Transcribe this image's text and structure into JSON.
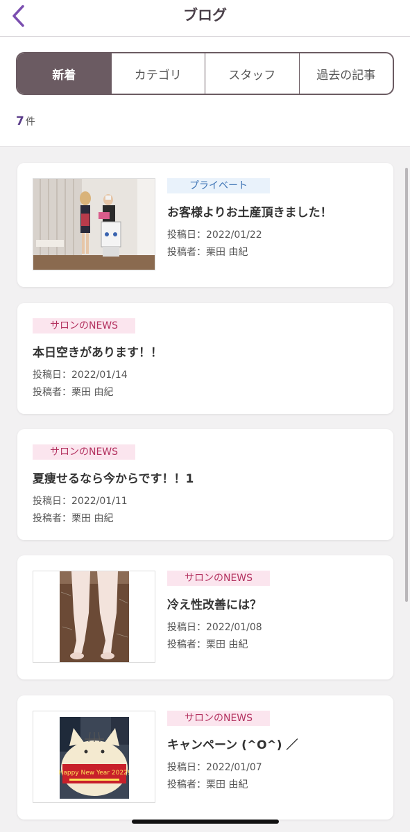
{
  "header": {
    "title": "ブログ"
  },
  "tabs": [
    {
      "label": "新着"
    },
    {
      "label": "カテゴリ"
    },
    {
      "label": "スタッフ"
    },
    {
      "label": "過去の記事"
    }
  ],
  "count": {
    "number": "7",
    "unit": "件"
  },
  "posts": [
    {
      "category": "プライベート",
      "title": "お客様よりお土産頂きました！",
      "date": "投稿日：2022/01/22",
      "author": "投稿者：栗田 由紀"
    },
    {
      "category": "サロンのNEWS",
      "title": "本日空きがあります！！",
      "date": "投稿日：2022/01/14",
      "author": "投稿者：栗田 由紀"
    },
    {
      "category": "サロンのNEWS",
      "title": "夏痩せるなら今からです！！1",
      "date": "投稿日：2022/01/11",
      "author": "投稿者：栗田 由紀"
    },
    {
      "category": "サロンのNEWS",
      "title": "冷え性改善には？",
      "date": "投稿日：2022/01/08",
      "author": "投稿者：栗田 由紀"
    },
    {
      "category": "サロンのNEWS",
      "title": "キャンペーン (^O^) ／",
      "date": "投稿日：2022/01/07",
      "author": "投稿者：栗田 由紀",
      "image_text": "Happy New Year 2022!"
    }
  ]
}
